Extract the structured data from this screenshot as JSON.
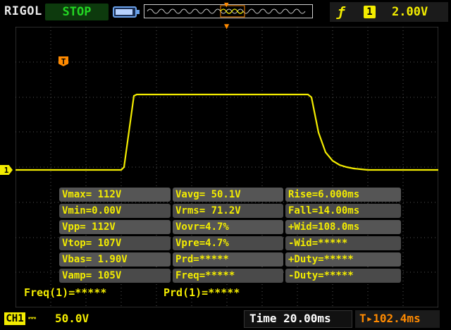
{
  "top": {
    "brand": "RIGOL",
    "run_state": "STOP",
    "trigger": {
      "edge_icon": "rising-edge-icon",
      "edge_glyph": "ƒ",
      "channel": "1",
      "level": "2.00V"
    }
  },
  "screen": {
    "trigger_marker": "T",
    "channel_marker": "1",
    "trace_color": "#f3ec00",
    "grid_color": "#555555"
  },
  "measurements": [
    [
      "Vmax= 112V",
      "Vavg= 50.1V",
      "Rise=6.000ms"
    ],
    [
      "Vmin=0.00V",
      "Vrms= 71.2V",
      "Fall=14.00ms"
    ],
    [
      "Vpp= 112V",
      "Vovr=4.7%",
      "+Wid=108.0ms"
    ],
    [
      "Vtop= 107V",
      "Vpre=4.7%",
      "-Wid=*****"
    ],
    [
      "Vbas= 1.90V",
      "Prd=*****",
      "+Duty=*****"
    ],
    [
      "Vamp= 105V",
      "Freq=*****",
      "-Duty=*****"
    ]
  ],
  "counter": {
    "freq": "Freq(1)=*****",
    "prd": "Prd(1)=*****"
  },
  "bottom": {
    "channel_label": "CH1",
    "coupling": "DC",
    "volts_per_div": "50.0V",
    "time_label": "Time",
    "time_per_div": "20.00ms",
    "trigger_offset": "102.4ms"
  },
  "colors": {
    "accent": "#f3ec00",
    "trigger": "#ff8a00",
    "run_green": "#23d723"
  }
}
